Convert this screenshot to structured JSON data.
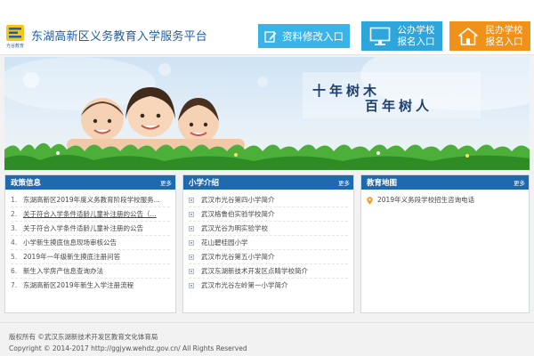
{
  "header": {
    "logo_caption": "光谷教育",
    "site_title": "东湖高新区义务教育入学服务平台",
    "buttons": {
      "edit_info": "资料修改入口",
      "public_school_line1": "公办学校",
      "public_school_line2": "报名入口",
      "private_school_line1": "民办学校",
      "private_school_line2": "报名入口"
    },
    "icons": {
      "edit": "edit-pencil-icon",
      "public": "monitor-icon",
      "private": "house-icon"
    },
    "colors": {
      "title": "#1f5fa8",
      "edit_button": "#3ab4e8",
      "public_button": "#2ea6dc",
      "private_button": "#f0921a"
    }
  },
  "banner": {
    "slogan_line1": "十年树木",
    "slogan_line2": "百年树人"
  },
  "panels": {
    "policy": {
      "title": "政策信息",
      "more": "更多",
      "items": [
        {
          "num": "1.",
          "text": "东湖高新区2019年度义务教育阶段学校服务..."
        },
        {
          "num": "2.",
          "text": "关于符合入学条件适龄儿童补注册的公告（..."
        },
        {
          "num": "3.",
          "text": "关于符合入学条件适龄儿童补注册的公告"
        },
        {
          "num": "4.",
          "text": "小学新生摸底信息现场审核公告"
        },
        {
          "num": "5.",
          "text": "2019年一年级新生摸底注册问答"
        },
        {
          "num": "6.",
          "text": "新生入学房产信息查询办法"
        },
        {
          "num": "7.",
          "text": "东湖高新区2019年新生入学注册流程"
        }
      ]
    },
    "schools": {
      "title": "小学介绍",
      "more": "更多",
      "items": [
        {
          "text": "武汉市光谷第四小学简介"
        },
        {
          "text": "武汉格鲁伯实验学校简介"
        },
        {
          "text": "武汉光谷为明实验学校"
        },
        {
          "text": "花山碧桂园小学"
        },
        {
          "text": "武汉市光谷第五小学简介"
        },
        {
          "text": "武汉东湖新技术开发区点睛学校简介"
        },
        {
          "text": "武汉市光谷左岭第一小学简介"
        }
      ]
    },
    "map": {
      "title": "教育地图",
      "more": "更多",
      "items": [
        {
          "text": "2019年义务段学校招生咨询电话"
        }
      ]
    },
    "colors": {
      "panel_header": "#1f6aaf",
      "map_pin": "#f0a020"
    }
  },
  "footer": {
    "line1": "版权所有 ©武汉东湖新技术开发区教育文化体育局",
    "line2": "Copyright © 2014-2017 http://ggjyw.wehdz.gov.cn/ All Rights Reserved"
  }
}
